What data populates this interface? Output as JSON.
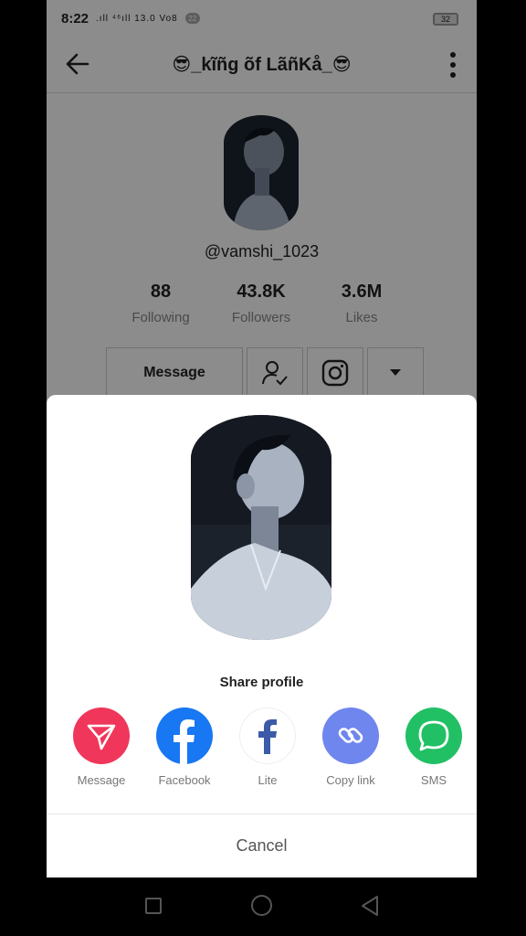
{
  "status_bar": {
    "time": "8:22",
    "signal": ".ıll ⁴⁶ıll 13.0 Vo8",
    "badge": "22",
    "battery": "32"
  },
  "header": {
    "title": "😎_kĩñg õf LãñKå_😎"
  },
  "profile": {
    "username": "@vamshi_1023",
    "stats": [
      {
        "value": "88",
        "label": "Following"
      },
      {
        "value": "43.8K",
        "label": "Followers"
      },
      {
        "value": "3.6M",
        "label": "Likes"
      }
    ],
    "message_label": "Message"
  },
  "share_sheet": {
    "title": "Share profile",
    "options": [
      {
        "label": "Message",
        "color": "#F0365A"
      },
      {
        "label": "Facebook",
        "color": "#1877F2"
      },
      {
        "label": "Lite",
        "color": "#ffffff"
      },
      {
        "label": "Copy link",
        "color": "#6F86EE"
      },
      {
        "label": "SMS",
        "color": "#21C064"
      }
    ],
    "cancel_label": "Cancel"
  }
}
